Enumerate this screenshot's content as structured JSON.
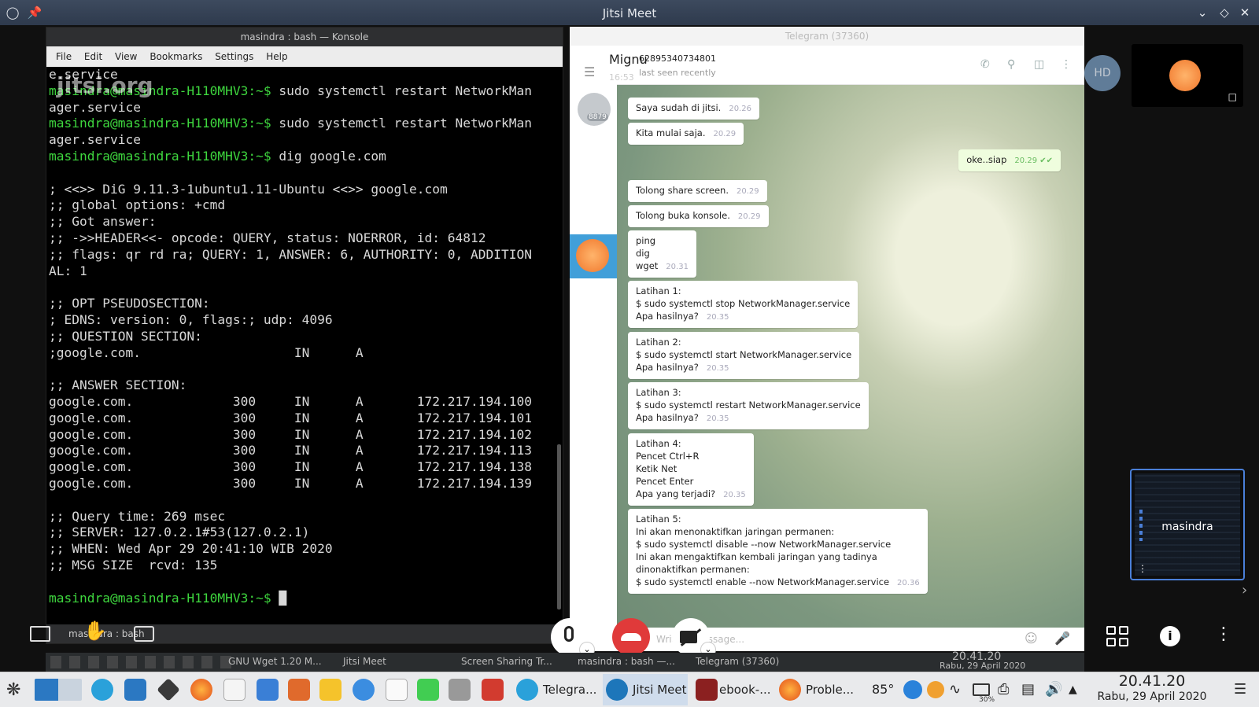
{
  "window": {
    "title": "Jitsi Meet"
  },
  "konsole": {
    "title": "masindra : bash — Konsole",
    "menu": [
      "File",
      "Edit",
      "View",
      "Bookmarks",
      "Settings",
      "Help"
    ],
    "terminal_lines": [
      "e.service",
      "masindra@masindra-H110MHV3:~$ sudo systemctl restart NetworkMan",
      "ager.service",
      "masindra@masindra-H110MHV3:~$ sudo systemctl restart NetworkMan",
      "ager.service",
      "masindra@masindra-H110MHV3:~$ dig google.com",
      "",
      "; <<>> DiG 9.11.3-1ubuntu1.11-Ubuntu <<>> google.com",
      ";; global options: +cmd",
      ";; Got answer:",
      ";; ->>HEADER<<- opcode: QUERY, status: NOERROR, id: 64812",
      ";; flags: qr rd ra; QUERY: 1, ANSWER: 6, AUTHORITY: 0, ADDITION",
      "AL: 1",
      "",
      ";; OPT PSEUDOSECTION:",
      "; EDNS: version: 0, flags:; udp: 4096",
      ";; QUESTION SECTION:",
      ";google.com.                    IN      A",
      "",
      ";; ANSWER SECTION:",
      "google.com.             300     IN      A       172.217.194.100",
      "google.com.             300     IN      A       172.217.194.101",
      "google.com.             300     IN      A       172.217.194.102",
      "google.com.             300     IN      A       172.217.194.113",
      "google.com.             300     IN      A       172.217.194.138",
      "google.com.             300     IN      A       172.217.194.139",
      "",
      ";; Query time: 269 msec",
      ";; SERVER: 127.0.2.1#53(127.0.2.1)",
      ";; WHEN: Wed Apr 29 20:41:10 WIB 2020",
      ";; MSG SIZE  rcvd: 135",
      "",
      "masindra@masindra-H110MHV3:~$ █"
    ],
    "tab_label": "masindra : bash"
  },
  "jitsi": {
    "watermark": "jitsi.org",
    "participant_name": "masindra",
    "hd_badge": "HD"
  },
  "telegram": {
    "window_title": "Telegram (37360)",
    "chat_name": "Mignu",
    "phone": "62895340734801",
    "time_overlay": "16:53",
    "status": "last seen recently",
    "badge": "8879",
    "input_placeholder": "Write a message...",
    "messages": [
      {
        "text": "Saya sudah di jitsi.",
        "time": "20.26",
        "dir": "in"
      },
      {
        "text": "Kita mulai saja.",
        "time": "20.29",
        "dir": "in"
      },
      {
        "text": "oke..siap",
        "time": "20.29",
        "dir": "out"
      },
      {
        "text": "Tolong share screen.",
        "time": "20.29",
        "dir": "in"
      },
      {
        "text": "Tolong buka konsole.",
        "time": "20.29",
        "dir": "in"
      },
      {
        "text": "ping\ndig\nwget",
        "time": "20.31",
        "dir": "in"
      },
      {
        "text": "Latihan 1:\n$ sudo systemctl stop NetworkManager.service\nApa hasilnya?",
        "time": "20.35",
        "dir": "in"
      },
      {
        "text": "Latihan 2:\n$ sudo systemctl start NetworkManager.service\nApa hasilnya?",
        "time": "20.35",
        "dir": "in"
      },
      {
        "text": "Latihan 3:\n$ sudo systemctl restart NetworkManager.service\nApa hasilnya?",
        "time": "20.35",
        "dir": "in"
      },
      {
        "text": "Latihan 4:\nPencet Ctrl+R\nKetik Net\nPencet Enter\nApa yang terjadi?",
        "time": "20.35",
        "dir": "in"
      },
      {
        "text": "Latihan 5:\nIni akan menonaktifkan jaringan permanen:\n$ sudo systemctl disable --now NetworkManager.service\nIni akan mengaktifkan kembali jaringan yang tadinya\ndinonaktifkan permanen:\n$ sudo systemctl enable --now NetworkManager.service",
        "time": "20.36",
        "dir": "in"
      }
    ]
  },
  "shared_taskbar": {
    "items": [
      "GNU Wget 1.20 M...",
      "Jitsi Meet",
      "Screen Sharing Tr...",
      "masindra : bash —...",
      "Telegram (37360)"
    ],
    "clock_time": "20.41.20",
    "clock_date": "Rabu, 29 April 2020"
  },
  "taskbar": {
    "tasks": [
      "Telegra...",
      "Jitsi Meet",
      "ebook-...",
      "Proble..."
    ],
    "temperature": "85°",
    "battery": "30%",
    "time": "20.41.20",
    "date": "Rabu, 29 April 2020"
  },
  "colors": {
    "accent": "#4a7fd8",
    "hangup": "#e03a3a",
    "prompt": "#3ed63e"
  }
}
